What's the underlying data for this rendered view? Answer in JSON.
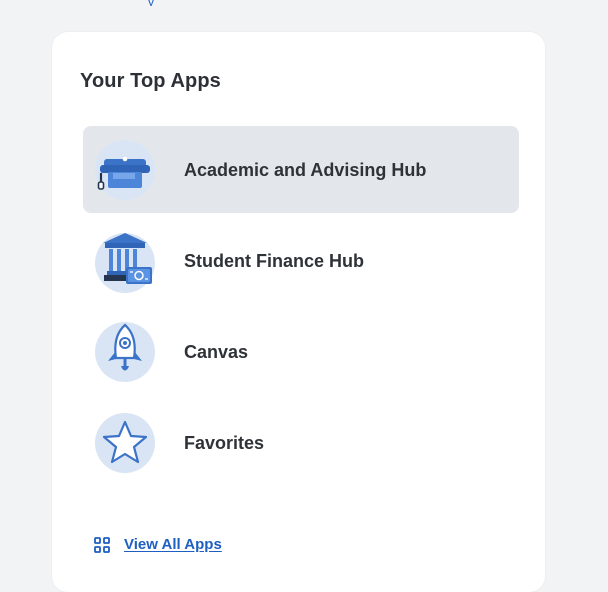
{
  "fragment": "y",
  "top_apps": {
    "title": "Your Top Apps",
    "items": [
      {
        "label": "Academic and Advising Hub",
        "icon": "graduation-cap-icon",
        "active": true
      },
      {
        "label": "Student Finance Hub",
        "icon": "bank-money-icon",
        "active": false
      },
      {
        "label": "Canvas",
        "icon": "rocket-icon",
        "active": false
      },
      {
        "label": "Favorites",
        "icon": "star-icon",
        "active": false
      }
    ],
    "view_all_label": "View All Apps"
  },
  "colors": {
    "background": "#f1f3f5",
    "card": "#ffffff",
    "active_row": "#e3e6ea",
    "link": "#1e5fc1",
    "icon_primary": "#3b73c8",
    "icon_light": "#dbe7f6"
  }
}
